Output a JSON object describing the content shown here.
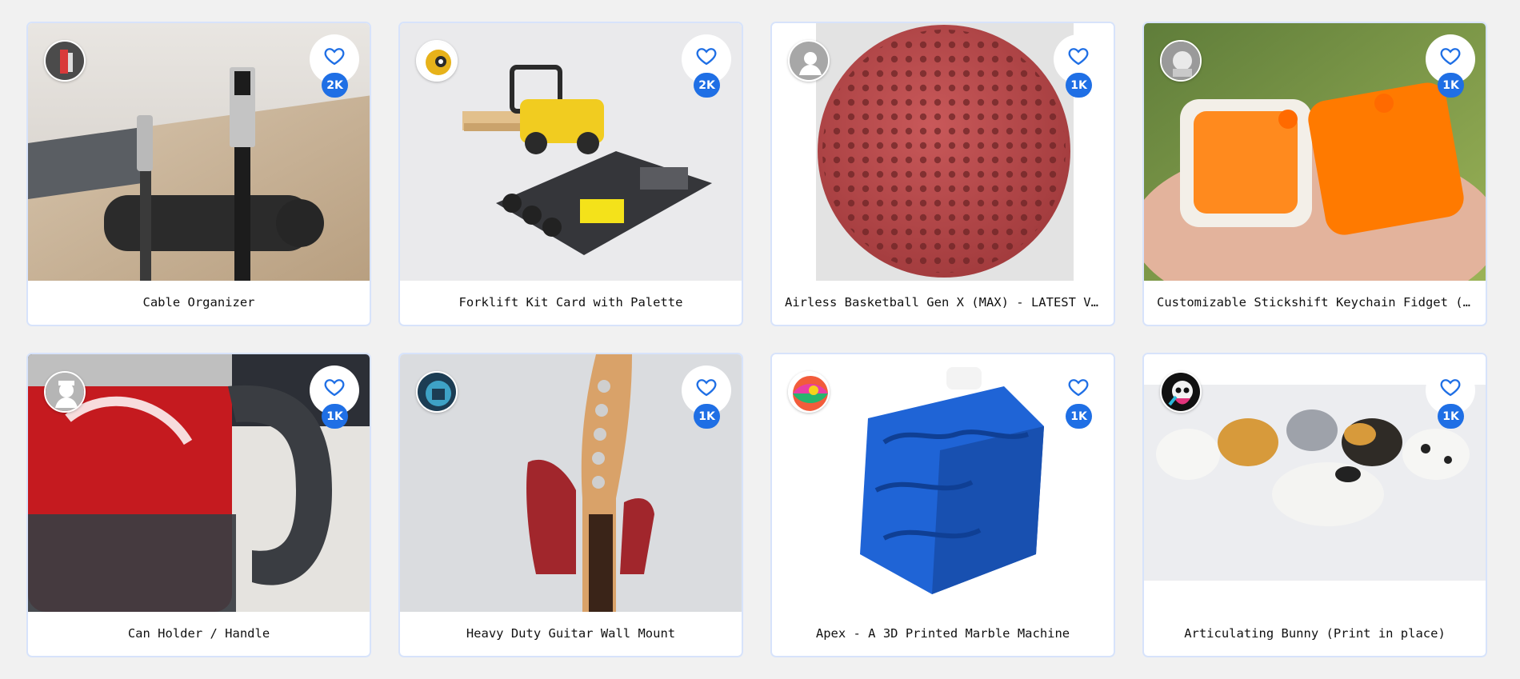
{
  "cards": [
    {
      "title": "Cable Organizer",
      "likes": "2K"
    },
    {
      "title": "Forklift Kit Card with Palette",
      "likes": "2K"
    },
    {
      "title": "Airless Basketball Gen X (MAX) - LATEST VE…",
      "likes": "1K"
    },
    {
      "title": "Customizable Stickshift Keychain Fidget (G…",
      "likes": "1K"
    },
    {
      "title": "Can Holder / Handle",
      "likes": "1K"
    },
    {
      "title": "Heavy Duty Guitar Wall Mount",
      "likes": "1K"
    },
    {
      "title": "Apex - A 3D Printed Marble Machine",
      "likes": "1K"
    },
    {
      "title": "Articulating Bunny (Print in place)",
      "likes": "1K"
    }
  ],
  "colors": {
    "accent": "#1f6fe5",
    "card_border": "#d7e3fb",
    "background": "#f1f1f1"
  },
  "icons": {
    "like": "heart-outline-icon"
  }
}
